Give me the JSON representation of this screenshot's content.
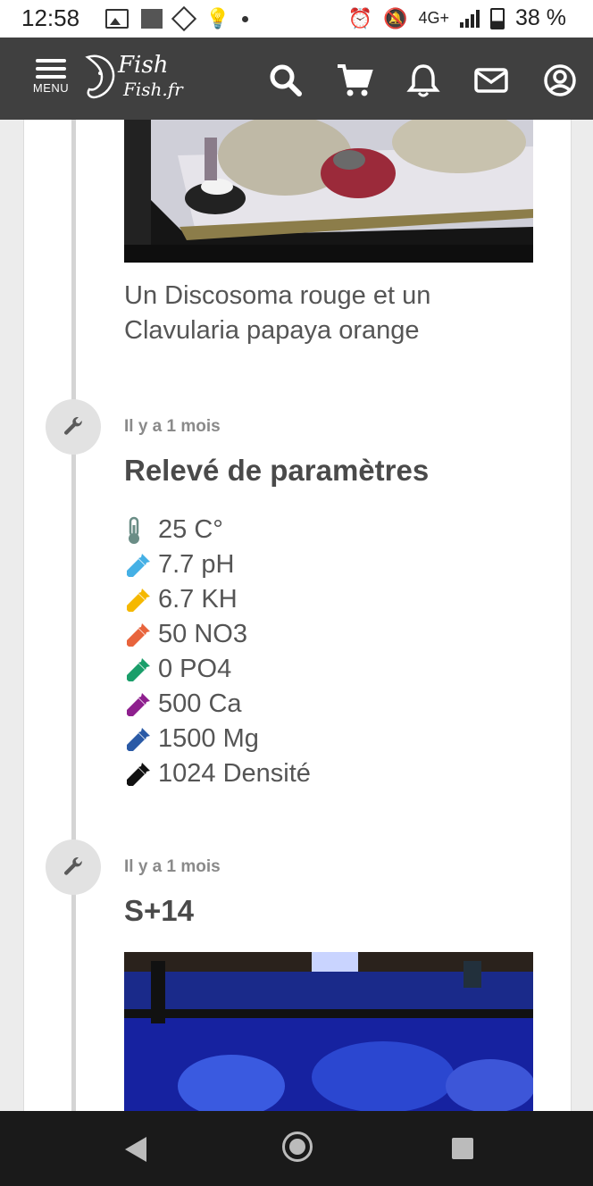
{
  "status_bar": {
    "time": "12:58",
    "network": "4G+",
    "battery": "38 %"
  },
  "header": {
    "menu_label": "MENU",
    "logo_line1": "Fish",
    "logo_line2": "Fish.fr",
    "icons": [
      "search-icon",
      "cart-icon",
      "bell-icon",
      "mail-icon",
      "user-icon"
    ]
  },
  "timeline": {
    "photo_caption": "Un Discosoma rouge et un Clavularia papaya orange",
    "entry1": {
      "time_ago": "Il y a 1 mois",
      "title": "Relevé de paramètres",
      "params": [
        {
          "label": "25 C°",
          "color": "#6a8d86",
          "icon": "thermometer-icon"
        },
        {
          "label": "7.7 pH",
          "color": "#45b0e5",
          "icon": "dropper-icon"
        },
        {
          "label": "6.7 KH",
          "color": "#f5b800",
          "icon": "dropper-icon"
        },
        {
          "label": "50 NO3",
          "color": "#e8643c",
          "icon": "dropper-icon"
        },
        {
          "label": "0 PO4",
          "color": "#1a9e6a",
          "icon": "dropper-icon"
        },
        {
          "label": "500 Ca",
          "color": "#8e1f8e",
          "icon": "dropper-icon"
        },
        {
          "label": "1500 Mg",
          "color": "#2a5aa6",
          "icon": "dropper-icon"
        },
        {
          "label": "1024 Densité",
          "color": "#111111",
          "icon": "dropper-icon"
        }
      ]
    },
    "entry2": {
      "time_ago": "Il y a 1 mois",
      "title": "S+14"
    }
  }
}
